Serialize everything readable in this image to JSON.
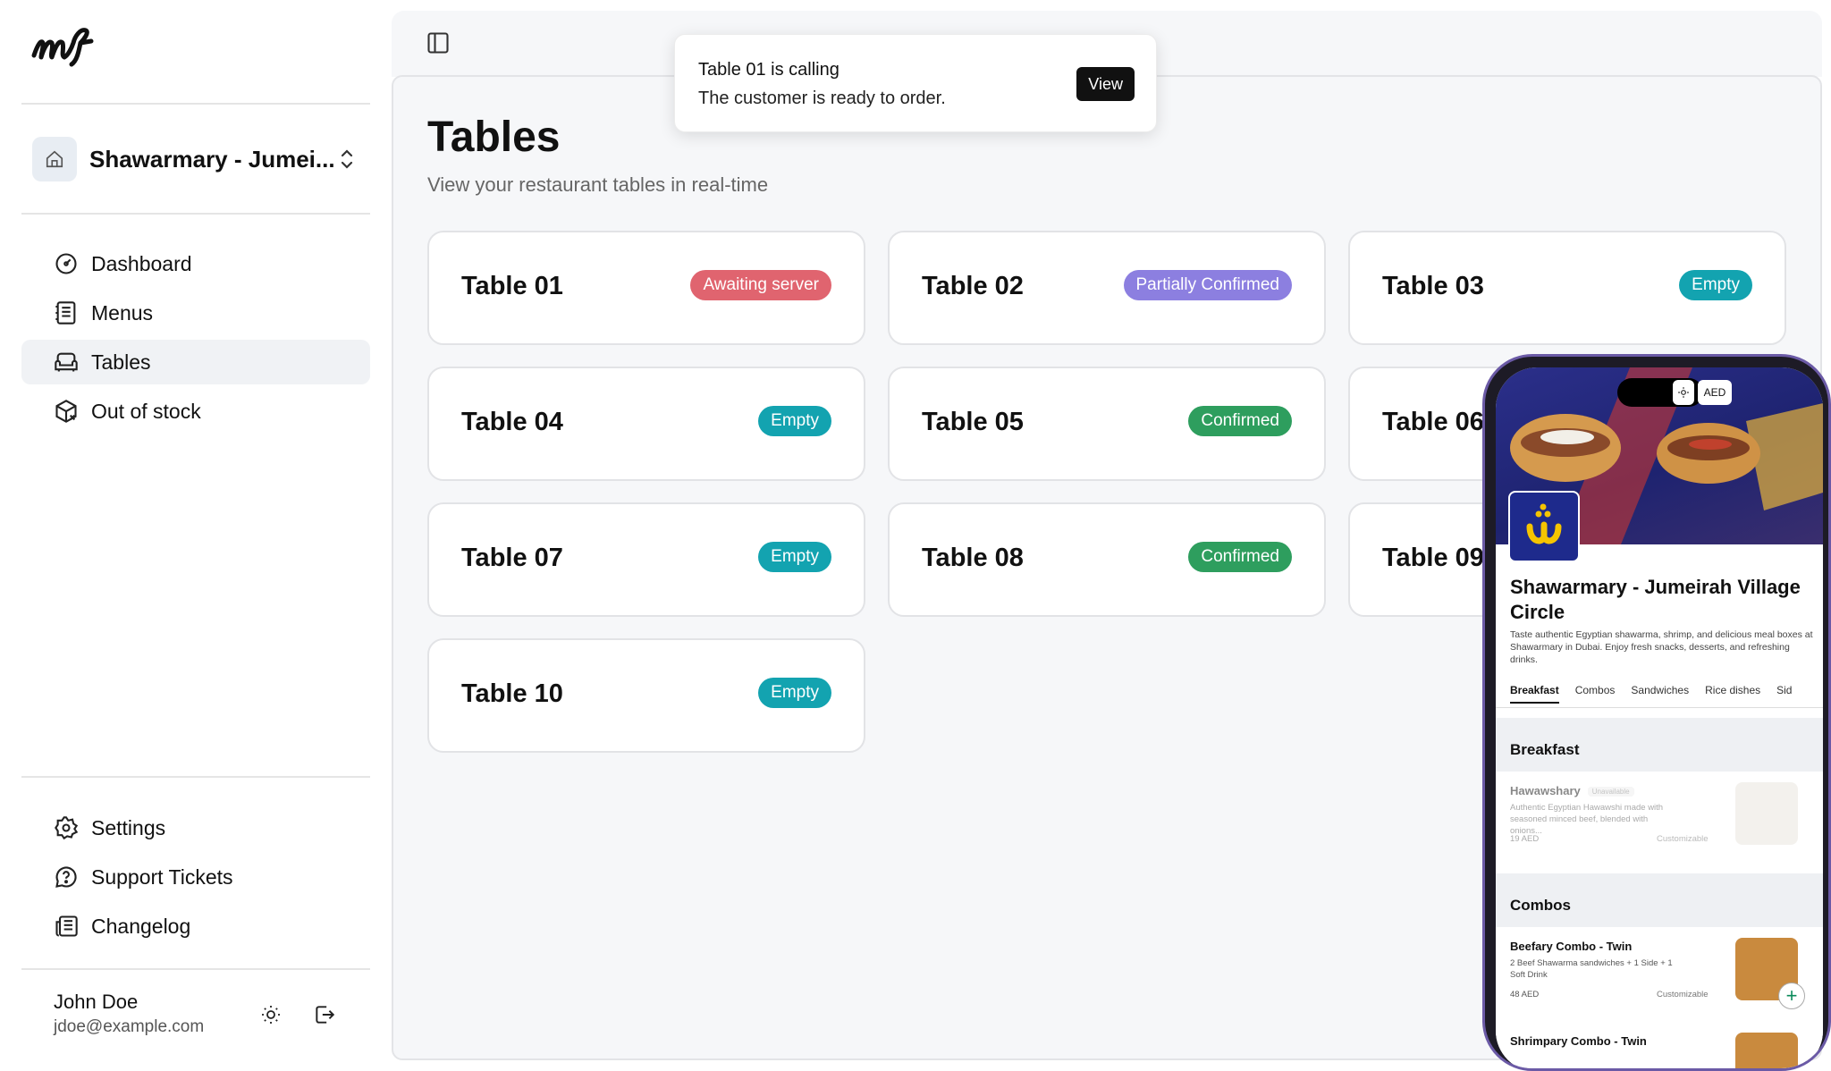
{
  "sidebar": {
    "restaurant_name": "Shawarmary - Jumei...",
    "nav_top": [
      {
        "label": "Dashboard",
        "icon": "dashboard-icon"
      },
      {
        "label": "Menus",
        "icon": "menu-book-icon"
      },
      {
        "label": "Tables",
        "icon": "sofa-icon",
        "active": true
      },
      {
        "label": "Out of stock",
        "icon": "package-x-icon"
      }
    ],
    "nav_bottom": [
      {
        "label": "Settings",
        "icon": "gear-icon"
      },
      {
        "label": "Support Tickets",
        "icon": "help-circle-icon"
      },
      {
        "label": "Changelog",
        "icon": "newspaper-icon"
      }
    ],
    "user": {
      "name": "John Doe",
      "email": "jdoe@example.com"
    }
  },
  "page": {
    "title": "Tables",
    "subtitle": "View your restaurant tables in real-time"
  },
  "toast": {
    "title": "Table 01 is calling",
    "message": "The customer is ready to order.",
    "action": "View"
  },
  "tables": [
    {
      "name": "Table 01",
      "status": "Awaiting server",
      "status_color": "#e0646f"
    },
    {
      "name": "Table 02",
      "status": "Partially Confirmed",
      "status_color": "#8c7fe0"
    },
    {
      "name": "Table 03",
      "status": "Empty",
      "status_color": "#13a3b0"
    },
    {
      "name": "Table 04",
      "status": "Empty",
      "status_color": "#13a3b0"
    },
    {
      "name": "Table 05",
      "status": "Confirmed",
      "status_color": "#2e9e5e"
    },
    {
      "name": "Table 06",
      "status": "",
      "status_color": "#13a3b0"
    },
    {
      "name": "Table 07",
      "status": "Empty",
      "status_color": "#13a3b0"
    },
    {
      "name": "Table 08",
      "status": "Confirmed",
      "status_color": "#2e9e5e"
    },
    {
      "name": "Table 09",
      "status": "",
      "status_color": "#13a3b0"
    },
    {
      "name": "Table 10",
      "status": "Empty",
      "status_color": "#13a3b0"
    }
  ],
  "phone": {
    "currency": "AED",
    "restaurant_title": "Shawarmary - Jumeirah Village Circle",
    "description": "Taste authentic Egyptian shawarma, shrimp, and delicious meal boxes at Shawarmary in Dubai. Enjoy fresh snacks, desserts, and refreshing drinks.",
    "tabs": [
      "Breakfast",
      "Combos",
      "Sandwiches",
      "Rice dishes",
      "Sid"
    ],
    "sections": [
      {
        "title": "Breakfast",
        "items": [
          {
            "name": "Hawawshary",
            "tag": "Unavailable",
            "desc": "Authentic Egyptian Hawawshi made with seasoned minced beef, blended with onions...",
            "price": "19 AED",
            "note": "Customizable"
          }
        ]
      },
      {
        "title": "Combos",
        "items": [
          {
            "name": "Beefary Combo - Twin",
            "desc": "2 Beef Shawarma sandwiches + 1 Side + 1 Soft Drink",
            "price": "48 AED",
            "note": "Customizable"
          },
          {
            "name": "Shrimpary Combo - Twin"
          }
        ]
      }
    ]
  }
}
